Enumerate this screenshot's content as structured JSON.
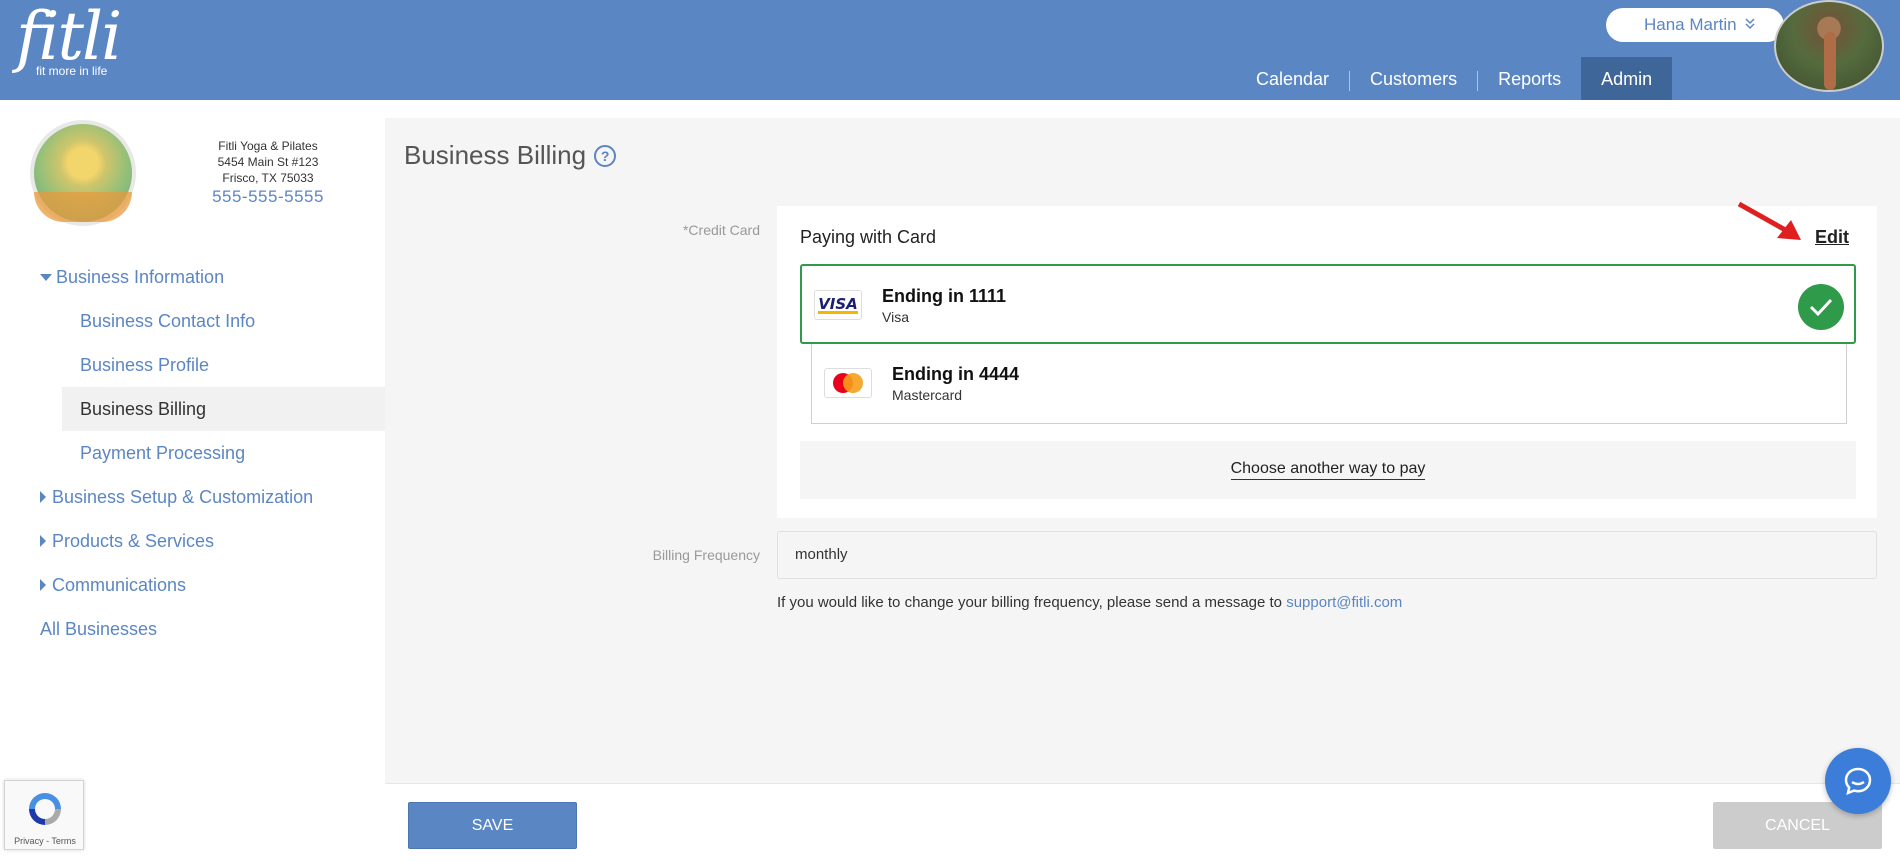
{
  "app": {
    "logo_text": "fitli",
    "logo_tagline": "fit more in life",
    "brand_color": "#5b86c4"
  },
  "user": {
    "name": "Hana Martin",
    "chevron_icon": "double-chevron-down-icon"
  },
  "nav": {
    "items": [
      {
        "label": "Calendar",
        "active": false
      },
      {
        "label": "Customers",
        "active": false
      },
      {
        "label": "Reports",
        "active": false
      },
      {
        "label": "Admin",
        "active": true
      }
    ]
  },
  "business": {
    "name": "Fitli Yoga & Pilates",
    "address1": "5454 Main St #123",
    "address2": "Frisco, TX 75033",
    "phone": "555-555-5555"
  },
  "sidebar": {
    "items": [
      {
        "label": "Business Information",
        "expanded": true
      },
      {
        "label": "Business Contact Info"
      },
      {
        "label": "Business Profile"
      },
      {
        "label": "Business Billing",
        "active": true
      },
      {
        "label": "Payment Processing"
      },
      {
        "label": "Business Setup & Customization",
        "expanded": false
      },
      {
        "label": "Products & Services",
        "expanded": false
      },
      {
        "label": "Communications",
        "expanded": false
      },
      {
        "label": "All Businesses"
      }
    ]
  },
  "main": {
    "title": "Business Billing",
    "help_icon": "question-circle-icon",
    "credit_card_label": "*Credit Card",
    "paying_with": "Paying with Card",
    "edit_label": "Edit",
    "cards": [
      {
        "title": "Ending in 1111",
        "brand": "Visa",
        "selected": true,
        "logo_text": "VISA"
      },
      {
        "title": "Ending in 4444",
        "brand": "Mastercard",
        "selected": false
      }
    ],
    "another_way": "Choose another way to pay",
    "billing_frequency_label": "Billing Frequency",
    "billing_frequency_value": "monthly",
    "note_text": "If you would like to change your billing frequency, please send a message to",
    "note_email": "support@fitli.com",
    "selected_color": "#2e9a4a"
  },
  "footer": {
    "save_label": "SAVE",
    "cancel_label": "CANCEL"
  },
  "recaptcha": {
    "privacy": "Privacy",
    "terms": "Terms",
    "separator": " - "
  }
}
